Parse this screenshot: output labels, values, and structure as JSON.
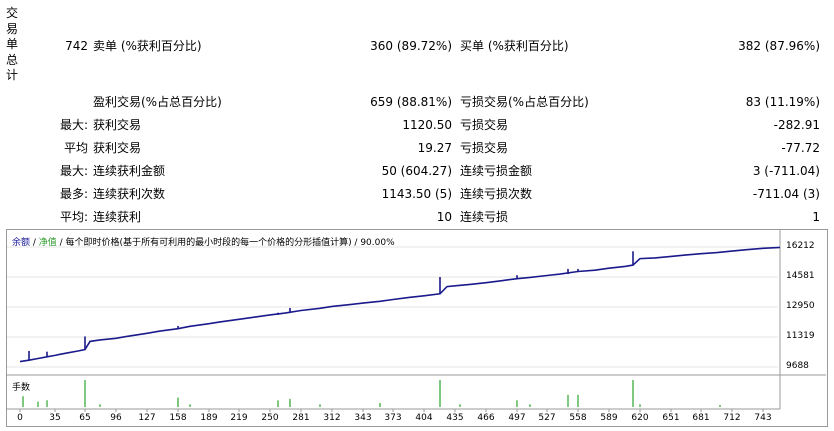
{
  "section_label": [
    "交",
    "易",
    "单",
    "总",
    "计"
  ],
  "summary": {
    "total_trades": "742",
    "short_label": "卖单 (%获利百分比)",
    "short_value": "360 (89.72%)",
    "long_label": "买单 (%获利百分比)",
    "long_value": "382 (87.96%)",
    "profit_trades_label": "盈利交易(%占总百分比)",
    "profit_trades_value": "659 (88.81%)",
    "loss_trades_label": "亏损交易(%占总百分比)",
    "loss_trades_value": "83 (11.19%)"
  },
  "rows": [
    {
      "prefix": "最大:",
      "left_label": "获利交易",
      "left_value": "1120.50",
      "right_label": "亏损交易",
      "right_value": "-282.91"
    },
    {
      "prefix": "平均",
      "left_label": "获利交易",
      "left_value": "19.27",
      "right_label": "亏损交易",
      "right_value": "-77.72"
    },
    {
      "prefix": "最大:",
      "left_label": "连续获利金额",
      "left_value": "50 (604.27)",
      "right_label": "连续亏损金额",
      "right_value": "3 (-711.04)"
    },
    {
      "prefix": "最多:",
      "left_label": "连续获利次数",
      "left_value": "1143.50 (5)",
      "right_label": "连续亏损次数",
      "right_value": "-711.04 (3)"
    },
    {
      "prefix": "平均:",
      "left_label": "连续获利",
      "left_value": "10",
      "right_label": "连续亏损",
      "right_value": "1"
    }
  ],
  "chart": {
    "title_balance": "余额",
    "title_sep1": " / ",
    "title_equity": "净值",
    "title_rest": " / 每个即时价格(基于所有可利用的最小时段的每一个价格的分形插值计算) / 90.00%",
    "volume_label": "手数"
  },
  "chart_data": {
    "type": "line",
    "series": [
      {
        "values": [
          [
            0,
            9980
          ],
          [
            9,
            10060
          ],
          [
            18,
            10150
          ],
          [
            27,
            10240
          ],
          [
            35,
            10320
          ],
          [
            40,
            10380
          ],
          [
            48,
            10460
          ],
          [
            58,
            10560
          ],
          [
            65,
            10640
          ],
          [
            70,
            11080
          ],
          [
            80,
            11160
          ],
          [
            96,
            11250
          ],
          [
            110,
            11380
          ],
          [
            127,
            11520
          ],
          [
            140,
            11640
          ],
          [
            158,
            11770
          ],
          [
            170,
            11900
          ],
          [
            189,
            12040
          ],
          [
            200,
            12140
          ],
          [
            219,
            12280
          ],
          [
            235,
            12400
          ],
          [
            250,
            12520
          ],
          [
            265,
            12620
          ],
          [
            281,
            12760
          ],
          [
            300,
            12880
          ],
          [
            312,
            12980
          ],
          [
            330,
            13080
          ],
          [
            343,
            13160
          ],
          [
            360,
            13260
          ],
          [
            373,
            13360
          ],
          [
            390,
            13480
          ],
          [
            404,
            13560
          ],
          [
            420,
            13670
          ],
          [
            427,
            14060
          ],
          [
            435,
            14100
          ],
          [
            450,
            14180
          ],
          [
            466,
            14270
          ],
          [
            480,
            14370
          ],
          [
            497,
            14490
          ],
          [
            510,
            14560
          ],
          [
            527,
            14660
          ],
          [
            540,
            14740
          ],
          [
            558,
            14880
          ],
          [
            575,
            14950
          ],
          [
            589,
            15060
          ],
          [
            605,
            15160
          ],
          [
            613,
            15230
          ],
          [
            620,
            15580
          ],
          [
            635,
            15620
          ],
          [
            651,
            15700
          ],
          [
            665,
            15770
          ],
          [
            681,
            15850
          ],
          [
            697,
            15910
          ],
          [
            712,
            15990
          ],
          [
            728,
            16070
          ],
          [
            743,
            16140
          ],
          [
            760,
            16190
          ]
        ]
      }
    ],
    "spikes": [
      [
        9,
        10560
      ],
      [
        27,
        10520
      ],
      [
        65,
        11350
      ],
      [
        158,
        11920
      ],
      [
        258,
        12640
      ],
      [
        270,
        12900
      ],
      [
        420,
        14580
      ],
      [
        497,
        14680
      ],
      [
        548,
        15020
      ],
      [
        558,
        15020
      ],
      [
        613,
        15980
      ]
    ],
    "volume_spikes": [
      [
        3,
        0.4
      ],
      [
        18,
        0.2
      ],
      [
        27,
        0.25
      ],
      [
        65,
        1
      ],
      [
        80,
        0.1
      ],
      [
        158,
        0.35
      ],
      [
        170,
        0.1
      ],
      [
        258,
        0.25
      ],
      [
        270,
        0.3
      ],
      [
        300,
        0.1
      ],
      [
        360,
        0.15
      ],
      [
        420,
        1
      ],
      [
        440,
        0.1
      ],
      [
        497,
        0.25
      ],
      [
        510,
        0.1
      ],
      [
        548,
        0.45
      ],
      [
        558,
        0.45
      ],
      [
        613,
        1
      ],
      [
        620,
        0.1
      ],
      [
        700,
        0.08
      ]
    ],
    "y_ticks": [
      "16212",
      "14581",
      "12950",
      "11319",
      "9688"
    ],
    "y_tick_values": [
      16212,
      14581,
      12950,
      11319,
      9688
    ],
    "ylim": [
      9688,
      16212
    ],
    "x_ticks": [
      "0",
      "35",
      "65",
      "96",
      "127",
      "158",
      "189",
      "219",
      "250",
      "281",
      "312",
      "343",
      "373",
      "404",
      "435",
      "466",
      "497",
      "527",
      "558",
      "589",
      "620",
      "651",
      "681",
      "712",
      "743"
    ],
    "xlim": [
      0,
      760
    ],
    "colors": {
      "balance": "#1a1a8c",
      "volume": "#2aa52a"
    }
  }
}
